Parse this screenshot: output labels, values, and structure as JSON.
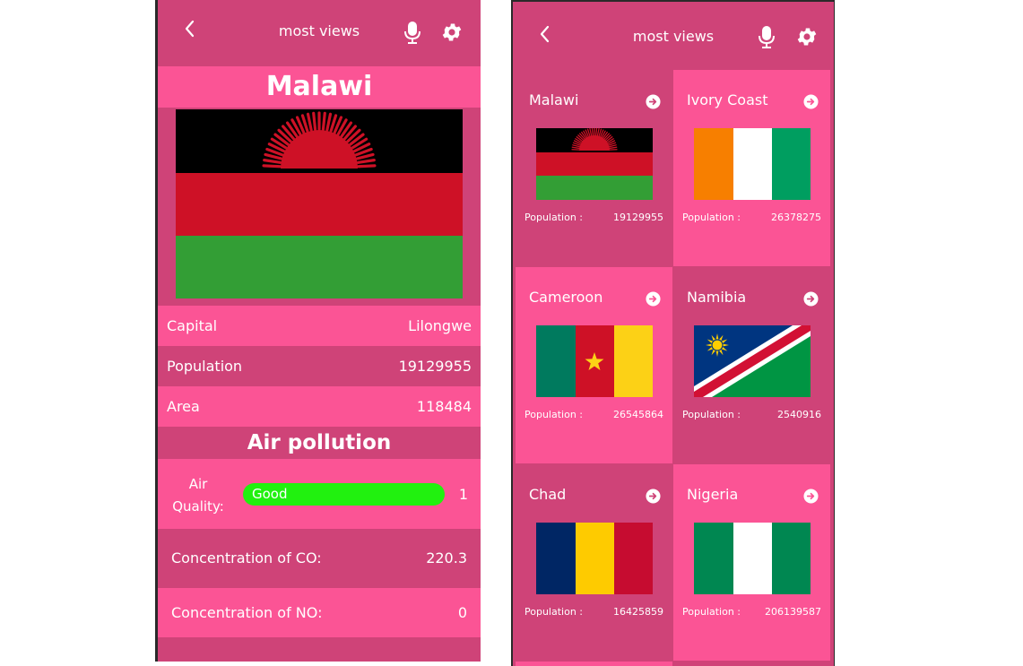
{
  "left_screen": {
    "header": {
      "title": "most views"
    },
    "country": {
      "name": "Malawi"
    },
    "info_rows": [
      {
        "label": "Capital",
        "value": "Lilongwe"
      },
      {
        "label": "Population",
        "value": "19129955"
      },
      {
        "label": "Area",
        "value": "118484"
      }
    ],
    "air_pollution": {
      "title": "Air pollution",
      "quality_label": "Air Quality:",
      "quality_status": "Good",
      "quality_index": "1",
      "quality_color": "#21f10f",
      "concentrations": [
        {
          "label": "Concentration of CO:",
          "value": "220.3"
        },
        {
          "label": "Concentration of NO:",
          "value": "0"
        }
      ]
    }
  },
  "right_screen": {
    "header": {
      "title": "most views"
    },
    "population_label": "Population :",
    "countries": [
      {
        "name": "Malawi",
        "population": "19129955",
        "flag": "malawi"
      },
      {
        "name": "Ivory Coast",
        "population": "26378275",
        "flag": "ivory-coast"
      },
      {
        "name": "Cameroon",
        "population": "26545864",
        "flag": "cameroon"
      },
      {
        "name": "Namibia",
        "population": "2540916",
        "flag": "namibia"
      },
      {
        "name": "Chad",
        "population": "16425859",
        "flag": "chad"
      },
      {
        "name": "Nigeria",
        "population": "206139587",
        "flag": "nigeria"
      }
    ]
  },
  "icons": {
    "back": "chevron-left-icon",
    "mic": "microphone-icon",
    "settings": "gear-icon",
    "open": "arrow-circle-right-icon"
  },
  "colors": {
    "header_bg": "#cf4378",
    "pink": "#fb5495",
    "dark_pink": "#cf4378",
    "good_green": "#21f10f"
  }
}
